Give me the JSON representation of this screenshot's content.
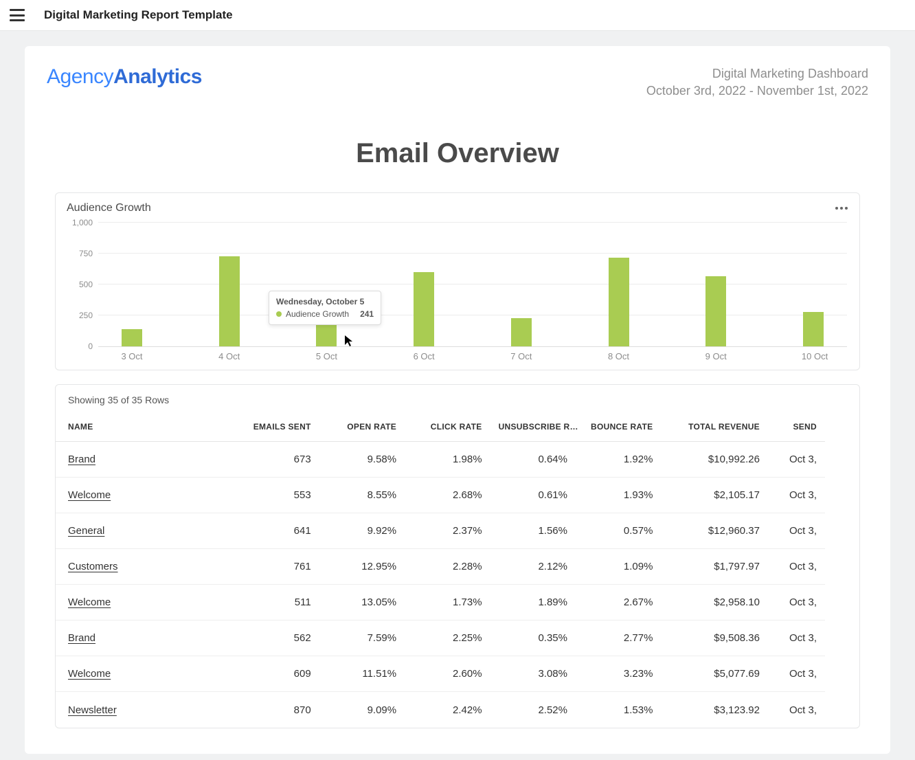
{
  "topbar": {
    "title": "Digital Marketing Report Template"
  },
  "logo": {
    "part1": "Agency",
    "part2": "Analytics"
  },
  "header": {
    "dashboard_name": "Digital Marketing Dashboard",
    "date_range": "October 3rd, 2022 - November 1st, 2022"
  },
  "section_title": "Email Overview",
  "chart": {
    "title": "Audience Growth",
    "tooltip": {
      "title": "Wednesday, October 5",
      "series_label": "Audience Growth",
      "value": "241"
    }
  },
  "chart_data": {
    "type": "bar",
    "title": "Audience Growth",
    "xlabel": "",
    "ylabel": "",
    "ylim": [
      0,
      1000
    ],
    "y_ticks": [
      0,
      250,
      500,
      750,
      1000
    ],
    "y_tick_labels": [
      "0",
      "250",
      "500",
      "750",
      "1,000"
    ],
    "categories": [
      "3 Oct",
      "4 Oct",
      "5 Oct",
      "6 Oct",
      "7 Oct",
      "8 Oct",
      "9 Oct",
      "10 Oct"
    ],
    "series": [
      {
        "name": "Audience Growth",
        "color": "#a9cc52",
        "values": [
          140,
          730,
          241,
          600,
          230,
          720,
          570,
          280
        ]
      }
    ]
  },
  "table": {
    "meta": "Showing 35 of 35 Rows",
    "columns": [
      "NAME",
      "EMAILS SENT",
      "OPEN RATE",
      "CLICK RATE",
      "UNSUBSCRIBE R…",
      "BOUNCE RATE",
      "TOTAL REVENUE",
      "SEND"
    ],
    "rows": [
      {
        "name": "Brand",
        "emails_sent": "673",
        "open_rate": "9.58%",
        "click_rate": "1.98%",
        "unsubscribe": "0.64%",
        "bounce": "1.92%",
        "revenue": "$10,992.26",
        "send": "Oct 3,"
      },
      {
        "name": "Welcome",
        "emails_sent": "553",
        "open_rate": "8.55%",
        "click_rate": "2.68%",
        "unsubscribe": "0.61%",
        "bounce": "1.93%",
        "revenue": "$2,105.17",
        "send": "Oct 3,"
      },
      {
        "name": "General",
        "emails_sent": "641",
        "open_rate": "9.92%",
        "click_rate": "2.37%",
        "unsubscribe": "1.56%",
        "bounce": "0.57%",
        "revenue": "$12,960.37",
        "send": "Oct 3,"
      },
      {
        "name": "Customers",
        "emails_sent": "761",
        "open_rate": "12.95%",
        "click_rate": "2.28%",
        "unsubscribe": "2.12%",
        "bounce": "1.09%",
        "revenue": "$1,797.97",
        "send": "Oct 3,"
      },
      {
        "name": "Welcome",
        "emails_sent": "511",
        "open_rate": "13.05%",
        "click_rate": "1.73%",
        "unsubscribe": "1.89%",
        "bounce": "2.67%",
        "revenue": "$2,958.10",
        "send": "Oct 3,"
      },
      {
        "name": "Brand",
        "emails_sent": "562",
        "open_rate": "7.59%",
        "click_rate": "2.25%",
        "unsubscribe": "0.35%",
        "bounce": "2.77%",
        "revenue": "$9,508.36",
        "send": "Oct 3,"
      },
      {
        "name": "Welcome",
        "emails_sent": "609",
        "open_rate": "11.51%",
        "click_rate": "2.60%",
        "unsubscribe": "3.08%",
        "bounce": "3.23%",
        "revenue": "$5,077.69",
        "send": "Oct 3,"
      },
      {
        "name": "Newsletter",
        "emails_sent": "870",
        "open_rate": "9.09%",
        "click_rate": "2.42%",
        "unsubscribe": "2.52%",
        "bounce": "1.53%",
        "revenue": "$3,123.92",
        "send": "Oct 3,"
      }
    ]
  }
}
